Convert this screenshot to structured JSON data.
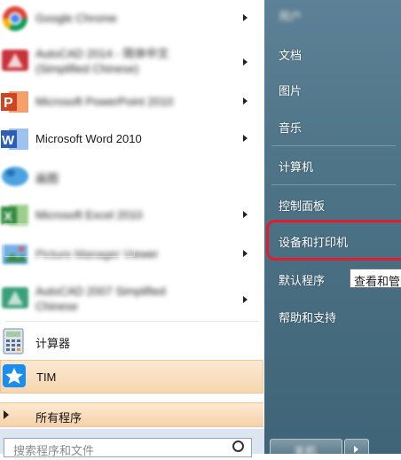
{
  "programs": [
    {
      "label": "Google Chrome",
      "blurred": true,
      "icon": "chrome-icon"
    },
    {
      "label": "AutoCAD 2014 - 简体中文 (Simplified Chinese)",
      "blurred": true,
      "icon": "autocad-icon"
    },
    {
      "label": "Microsoft PowerPoint 2010",
      "blurred": true,
      "icon": "powerpoint-icon"
    },
    {
      "label": "Microsoft Word 2010",
      "blurred": false,
      "icon": "word-icon"
    },
    {
      "label": "画图",
      "blurred": true,
      "icon": "paint-icon"
    },
    {
      "label": "Microsoft Excel 2010",
      "blurred": true,
      "icon": "excel-icon"
    },
    {
      "label": "Picture Manager Viewer",
      "blurred": true,
      "icon": "picture-viewer-icon"
    },
    {
      "label": "AutoCAD 2007 Simplified Chinese",
      "blurred": true,
      "icon": "autocad-2007-icon"
    }
  ],
  "calculator": {
    "label": "计算器",
    "icon": "calculator-icon"
  },
  "tim": {
    "label": "TIM",
    "icon": "tim-icon"
  },
  "all_programs": "所有程序",
  "search": {
    "placeholder": "搜索程序和文件"
  },
  "right_menu": {
    "user": "用户",
    "documents": "文档",
    "pictures": "图片",
    "music": "音乐",
    "computer": "计算机",
    "control_panel": "控制面板",
    "devices_printers": "设备和打印机",
    "default_programs": "默认程序",
    "help_support": "帮助和支持"
  },
  "tooltip": "查看和管",
  "shutdown": {
    "label": "关机"
  },
  "colors": {
    "highlight_ring": "#e11c2d",
    "accent": "#f7d6b0",
    "right_bg": "#4d7386"
  }
}
